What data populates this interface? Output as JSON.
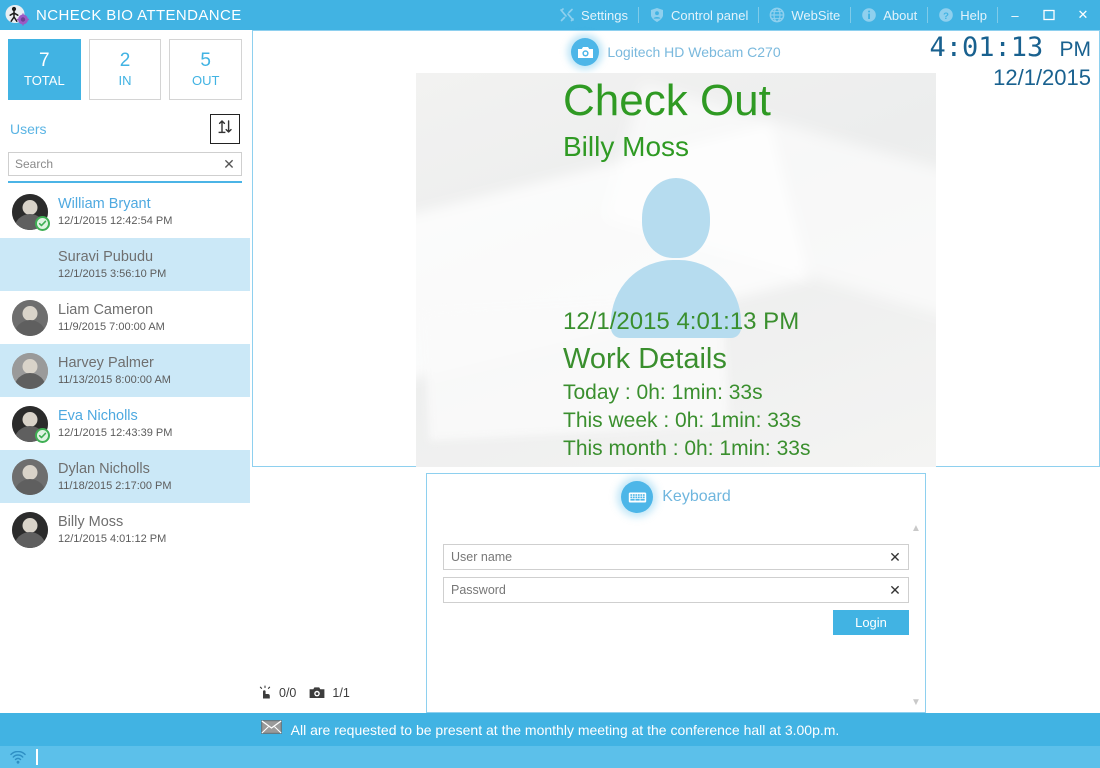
{
  "window": {
    "title": "NCHECK BIO ATTENDANCE",
    "logo_icon": "person-fingerprint-logo-icon",
    "menu": [
      {
        "label": "Settings",
        "icon": "tools-icon"
      },
      {
        "label": "Control panel",
        "icon": "shield-person-icon"
      },
      {
        "label": "WebSite",
        "icon": "globe-icon"
      },
      {
        "label": "About",
        "icon": "info-icon"
      },
      {
        "label": "Help",
        "icon": "question-icon"
      }
    ],
    "controls": [
      {
        "name": "minimize-button",
        "glyph": "–"
      },
      {
        "name": "maximize-button",
        "glyph": "❐"
      },
      {
        "name": "close-button",
        "glyph": "✕"
      }
    ]
  },
  "colors": {
    "brand_blue": "#41b3e3",
    "brand_blue_light": "#5cc0ea",
    "selection_blue": "#cbe8f7",
    "green_text": "#2f9a23",
    "clock_blue": "#19618f",
    "panel_border": "#8ed0ef"
  },
  "sidebar": {
    "stats": [
      {
        "value": "7",
        "label": "TOTAL",
        "active": true
      },
      {
        "value": "2",
        "label": "IN",
        "active": false
      },
      {
        "value": "5",
        "label": "OUT",
        "active": false
      }
    ],
    "users_label": "Users",
    "sort_button_icon": "sort-arrows-icon",
    "search": {
      "value": "",
      "placeholder": "Search",
      "clear_icon": "close-icon"
    },
    "users": [
      {
        "name": "William Bryant",
        "time": "12/1/2015 12:42:54 PM",
        "selected": false,
        "checked_in": true,
        "name_is_link": true,
        "avatar_tone": "dark"
      },
      {
        "name": "Suravi Pubudu",
        "time": "12/1/2015 3:56:10 PM",
        "selected": true,
        "checked_in": false,
        "name_is_link": false,
        "avatar_tone": "none"
      },
      {
        "name": "Liam Cameron",
        "time": "11/9/2015 7:00:00 AM",
        "selected": false,
        "checked_in": false,
        "name_is_link": false,
        "avatar_tone": "mid"
      },
      {
        "name": "Harvey Palmer",
        "time": "11/13/2015 8:00:00 AM",
        "selected": true,
        "checked_in": false,
        "name_is_link": false,
        "avatar_tone": "lite"
      },
      {
        "name": "Eva Nicholls",
        "time": "12/1/2015 12:43:39 PM",
        "selected": false,
        "checked_in": true,
        "name_is_link": true,
        "avatar_tone": "dark"
      },
      {
        "name": "Dylan Nicholls",
        "time": "11/18/2015 2:17:00 PM",
        "selected": true,
        "checked_in": false,
        "name_is_link": false,
        "avatar_tone": "mid"
      },
      {
        "name": "Billy Moss",
        "time": "12/1/2015 4:01:12 PM",
        "selected": false,
        "checked_in": false,
        "name_is_link": false,
        "avatar_tone": "dark"
      }
    ]
  },
  "camera": {
    "icon": "camera-icon",
    "device_name": "Logitech HD Webcam C270",
    "clock_time": "4:01:13",
    "clock_ampm": "PM",
    "clock_date": "12/1/2015",
    "avatar_placeholder_icon": "person-silhouette-icon",
    "overlay": {
      "action": "Check Out",
      "user_name": "Billy Moss",
      "timestamp": "12/1/2015 4:01:13 PM",
      "work_details_title": "Work Details",
      "details": [
        "Today : 0h: 1min: 33s",
        "This week : 0h: 1min: 33s",
        "This month : 0h: 1min: 33s"
      ]
    }
  },
  "keyboard_panel": {
    "icon": "keyboard-icon",
    "title": "Keyboard",
    "username": {
      "value": "",
      "placeholder": "User name",
      "clear_icon": "close-icon"
    },
    "password": {
      "value": "",
      "placeholder": "Password",
      "clear_icon": "close-icon"
    },
    "login_label": "Login",
    "scroll_up_icon": "chevron-up-icon",
    "scroll_down_icon": "chevron-down-icon"
  },
  "counters": {
    "fingerprint_icon": "fingerprint-touch-icon",
    "fingerprint_value": "0/0",
    "camera_icon": "camera-icon",
    "camera_value": "1/1"
  },
  "notification": {
    "icon": "envelope-icon",
    "message": "All are requested to be present at the monthly meeting at the conference hall at 3.00p.m."
  },
  "statusbar": {
    "connection_icon": "wifi-icon"
  }
}
